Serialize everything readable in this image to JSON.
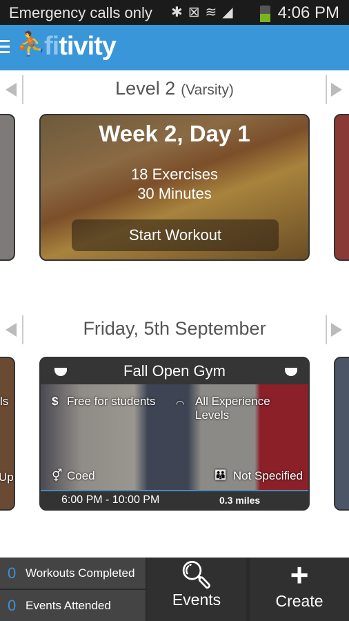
{
  "status_bar": {
    "carrier": "Emergency calls only",
    "time": "4:06 PM",
    "icons": [
      "bluetooth-icon",
      "mute-icon",
      "wifi-icon",
      "signal-icon",
      "battery-icon"
    ]
  },
  "header": {
    "logo_prefix": "fi",
    "logo_suffix": "tivity",
    "accent": "#3996d9"
  },
  "workouts": {
    "level": "Level 2",
    "level_sub": "(Varsity)",
    "card": {
      "title": "Week 2, Day 1",
      "exercises": "18 Exercises",
      "duration": "30 Minutes",
      "button": "Start Workout"
    }
  },
  "events": {
    "date": "Friday, 5th September",
    "card": {
      "title": "Fall Open Gym",
      "price": "Free for students",
      "experience": "All Experience Levels",
      "gender": "Coed",
      "age": "Not Specified",
      "time": "6:00 PM - 10:00 PM",
      "distance": "0.3 miles"
    },
    "left_partial": {
      "line1": "ls",
      "line2": "Up"
    }
  },
  "bottom": {
    "workouts_count": "0",
    "workouts_label": "Workouts Completed",
    "events_count": "0",
    "events_label": "Events Attended",
    "events_button": "Events",
    "create_button": "Create"
  }
}
